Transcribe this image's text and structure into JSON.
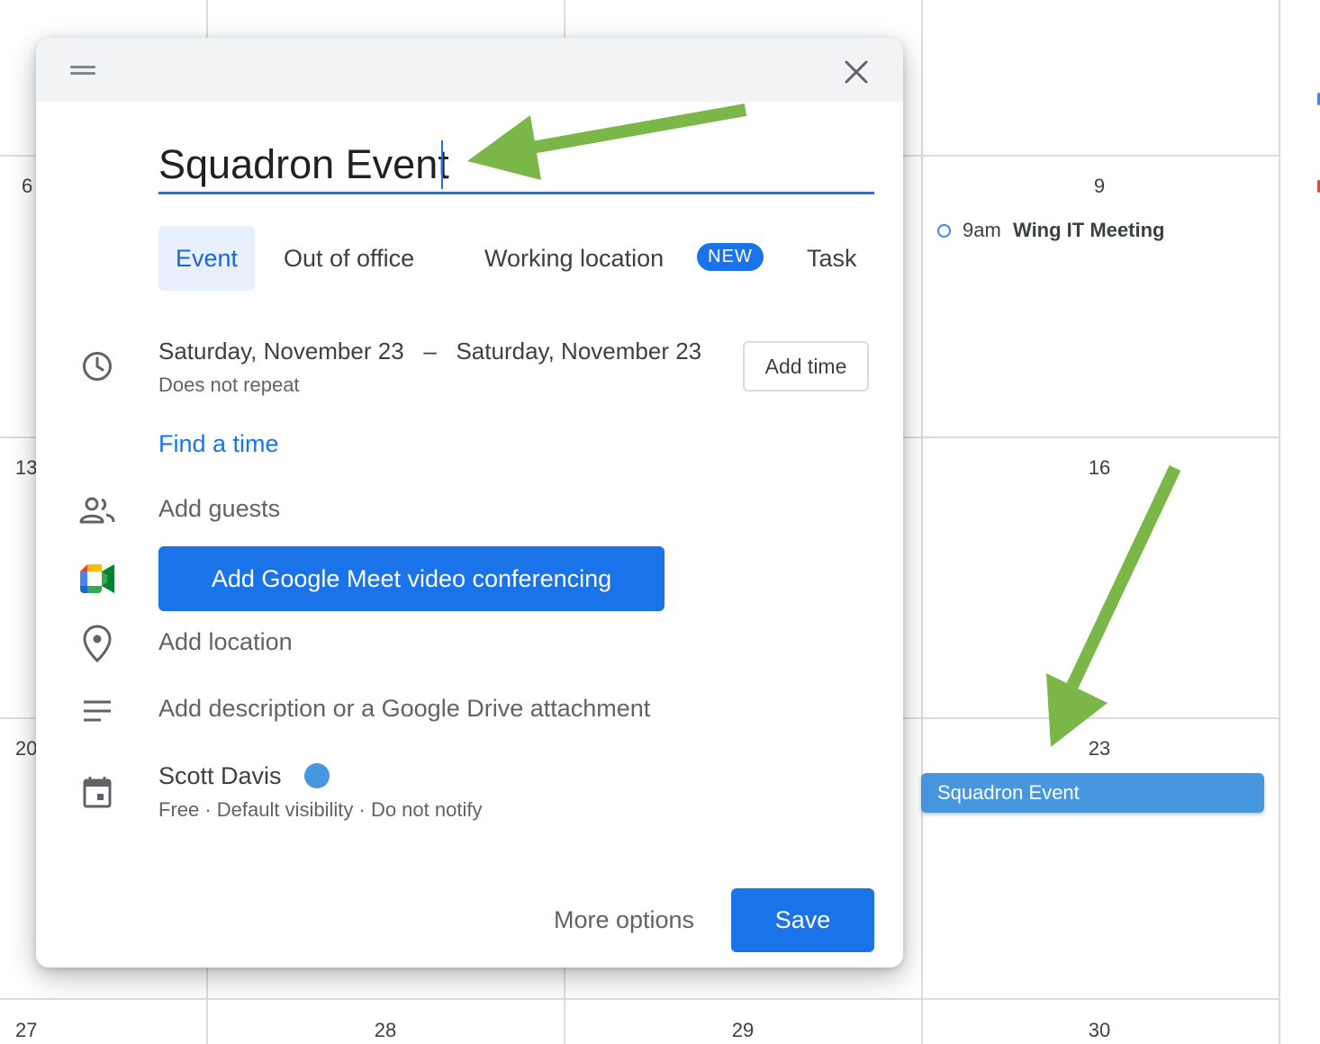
{
  "calendar": {
    "days": {
      "d6": "6",
      "d9": "9",
      "d13": "13",
      "d16": "16",
      "d20": "20",
      "d23": "23",
      "d27": "27",
      "d28": "28",
      "d29": "29",
      "d30": "30"
    },
    "events": {
      "wing_time": "9am",
      "wing_title": "Wing IT Meeting",
      "squadron_chip": "Squadron Event"
    }
  },
  "dialog": {
    "title_value": "Squadron Event",
    "tabs": {
      "event": "Event",
      "out_of_office": "Out of office",
      "working_location": "Working location",
      "new_badge": "NEW",
      "task": "Task"
    },
    "date_range": "Saturday, November 23   –   Saturday, November 23",
    "repeat": "Does not repeat",
    "add_time": "Add time",
    "find_time": "Find a time",
    "add_guests": "Add guests",
    "meet_button": "Add Google Meet video conferencing",
    "add_location": "Add location",
    "add_description": "Add description or a Google Drive attachment",
    "owner_name": "Scott Davis",
    "owner_meta": "Free · Default visibility · Do not notify",
    "more_options": "More options",
    "save": "Save"
  },
  "colors": {
    "accent": "#1a73e8",
    "event_chip": "#4796e0",
    "annotation_arrow": "#7ab648"
  },
  "icons": [
    "drag-handle-icon",
    "close-icon",
    "clock-icon",
    "people-icon",
    "google-meet-icon",
    "location-pin-icon",
    "description-icon",
    "calendar-icon"
  ]
}
